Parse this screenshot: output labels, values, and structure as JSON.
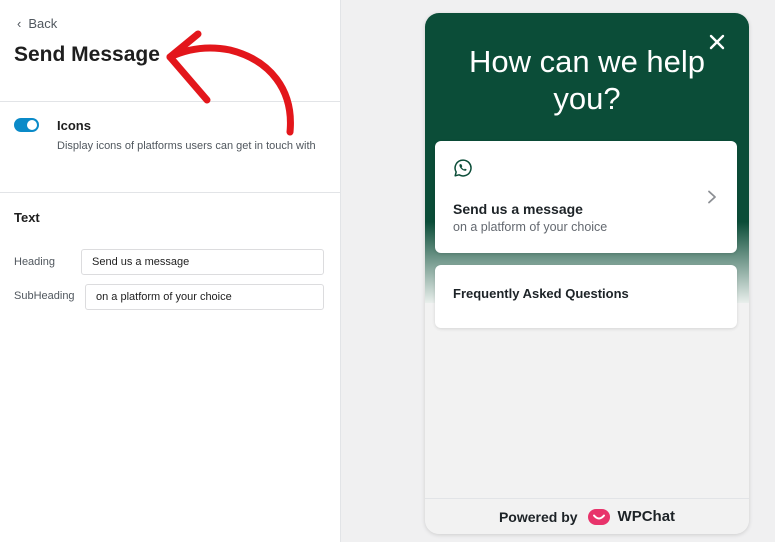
{
  "panel": {
    "back_label": "Back",
    "title": "Send Message",
    "icons_option": {
      "title": "Icons",
      "description": "Display icons of platforms users can get in touch with",
      "enabled": true
    },
    "text_section": "Text",
    "fields": {
      "heading_label": "Heading",
      "heading_value": "Send us a message",
      "subheading_label": "SubHeading",
      "subheading_value": "on a platform of your choice"
    }
  },
  "widget": {
    "heading": "How can we help you?",
    "cards": [
      {
        "title": "Send us a message",
        "subtitle": "on a platform of your choice",
        "icon": "whatsapp-icon"
      },
      {
        "title": "Frequently Asked Questions"
      }
    ],
    "footer": {
      "powered_by": "Powered by",
      "brand": "WPChat"
    }
  },
  "colors": {
    "accent": "#0a8ac8",
    "widget_header": "#0b4d38",
    "annotation_arrow": "#e3161b",
    "brand": "#e8336b"
  },
  "icons": [
    "chevron-left-icon",
    "close-icon",
    "whatsapp-icon",
    "chevron-right-icon",
    "wpchat-logo-icon",
    "annotation-arrow"
  ]
}
